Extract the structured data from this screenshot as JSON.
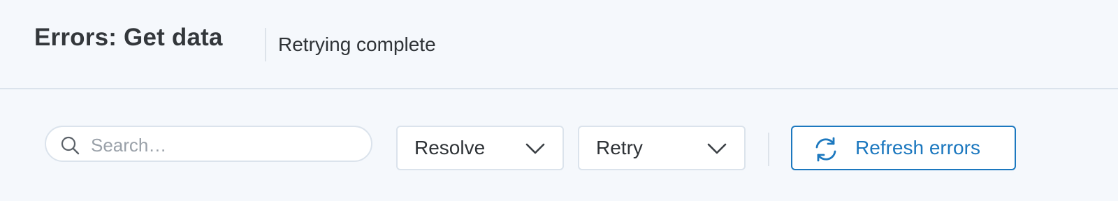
{
  "header": {
    "title": "Errors: Get data",
    "status": "Retrying complete"
  },
  "toolbar": {
    "search": {
      "placeholder": "Search…",
      "value": "",
      "icon": "search-icon"
    },
    "resolve_select": {
      "selected": "Resolve",
      "icon": "chevron-down-icon"
    },
    "retry_select": {
      "selected": "Retry",
      "icon": "chevron-down-icon"
    },
    "refresh_button": {
      "label": "Refresh errors",
      "icon": "refresh-icon"
    }
  },
  "colors": {
    "background": "#f5f8fc",
    "border": "#dbe3ec",
    "accent": "#1c78bf",
    "text": "#2f3337",
    "placeholder": "#9aa1a9"
  }
}
